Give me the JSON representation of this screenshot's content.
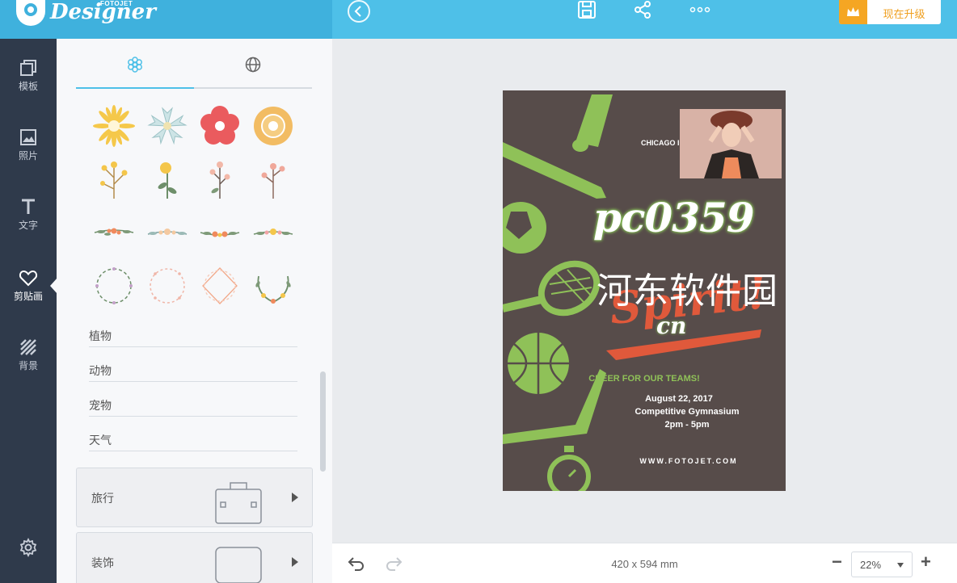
{
  "app": {
    "logo_text": "Designer",
    "logo_sub": "FOTOJET",
    "upgrade_label": "现在升级",
    "accent": "#4ec0e8",
    "sidebar_bg": "#2f3a4b",
    "upgrade_color": "#f5a623"
  },
  "toolbar": {
    "icons": [
      "back-icon",
      "save-icon",
      "share-icon",
      "more-icon"
    ]
  },
  "nav": {
    "items": [
      {
        "label": "模板",
        "icon": "template-icon"
      },
      {
        "label": "照片",
        "icon": "photo-icon"
      },
      {
        "label": "文字",
        "icon": "text-icon"
      },
      {
        "label": "剪贴画",
        "icon": "heart-icon",
        "active": true
      },
      {
        "label": "背景",
        "icon": "background-icon"
      }
    ],
    "settings_icon": "gear-icon"
  },
  "panel": {
    "tabs": [
      {
        "icon": "snowflake-icon",
        "active": true
      },
      {
        "icon": "globe-icon",
        "active": false
      }
    ],
    "clipart_rows": [
      [
        "sunflower-clipart",
        "pale-blue-flower-clipart",
        "red-flower-clipart",
        "orange-flower-clipart"
      ],
      [
        "yellow-sprig-clipart",
        "yellow-bud-clipart",
        "pink-sprig-clipart",
        "pink-blossom-clipart"
      ],
      [
        "garland-1-clipart",
        "garland-2-clipart",
        "garland-3-clipart",
        "garland-4-clipart"
      ],
      [
        "wreath-1-clipart",
        "wreath-2-clipart",
        "wreath-3-clipart",
        "wreath-4-clipart"
      ]
    ],
    "categories": [
      "植物",
      "动物",
      "宠物",
      "天气"
    ],
    "cards": [
      {
        "label": "旅行",
        "icon": "suitcase-icon"
      },
      {
        "label": "装饰",
        "icon": "frame-icon"
      }
    ]
  },
  "poster": {
    "city_text": "CHICAGO I",
    "watermark_en": "pc0359",
    "watermark_cn": "河东软件园",
    "headline": "Spirit!",
    "sub_headline": "cn",
    "cheer": "CHEER FOR OUR TEAMS!",
    "date": "August 22, 2017",
    "venue": "Competitive Gymnasium",
    "time": "2pm - 5pm",
    "website": "WWW.FOTOJET.COM",
    "bg_color": "#574c4a",
    "green": "#8fc158",
    "orange": "#e0593b"
  },
  "footer": {
    "size_label": "420 x 594 mm",
    "zoom": "22%",
    "minus": "−",
    "plus": "+"
  }
}
